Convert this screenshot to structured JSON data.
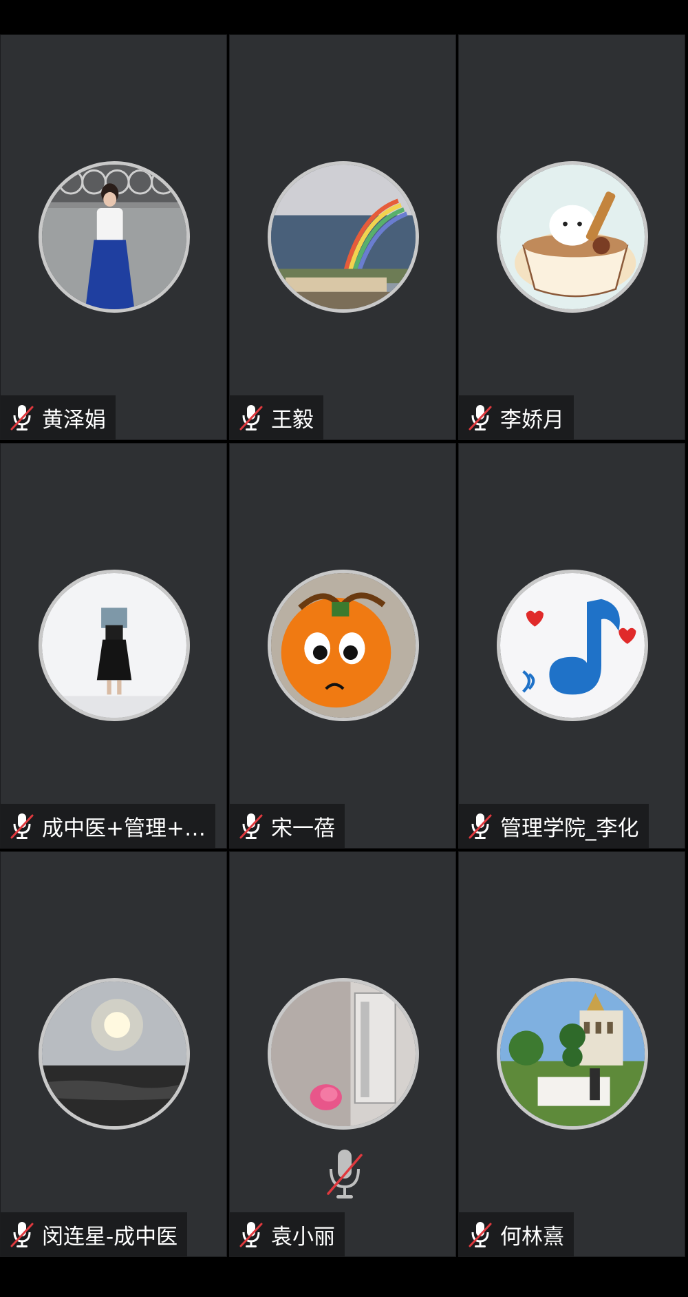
{
  "participants": [
    {
      "name": "黄泽娟",
      "avatar": "woman-blue-skirt-photo",
      "muted": true
    },
    {
      "name": "王毅",
      "avatar": "rainbow-landscape-photo",
      "muted": true
    },
    {
      "name": "李娇月",
      "avatar": "bunny-coffee-cup-cartoon",
      "muted": true
    },
    {
      "name": "成中医+管理+…",
      "avatar": "person-holding-book-photo",
      "muted": true
    },
    {
      "name": "宋一蓓",
      "avatar": "orange-face-with-bow",
      "muted": true
    },
    {
      "name": "管理学院_李化",
      "avatar": "blue-music-note-hearts",
      "muted": true
    },
    {
      "name": "闵连星-成中医",
      "avatar": "sunset-sea-photo",
      "muted": true
    },
    {
      "name": "袁小丽",
      "avatar": "glass-and-flower-photo",
      "muted": true
    },
    {
      "name": "何林熹",
      "avatar": "palace-garden-photo",
      "muted": true
    }
  ],
  "icons": {
    "label_mic": "mic-muted-icon",
    "center_mic": "mic-muted-large-icon"
  },
  "colors": {
    "tile_bg": "#2e3033",
    "label_bg": "#1b1c1e",
    "mute_slash": "#e0393e"
  }
}
